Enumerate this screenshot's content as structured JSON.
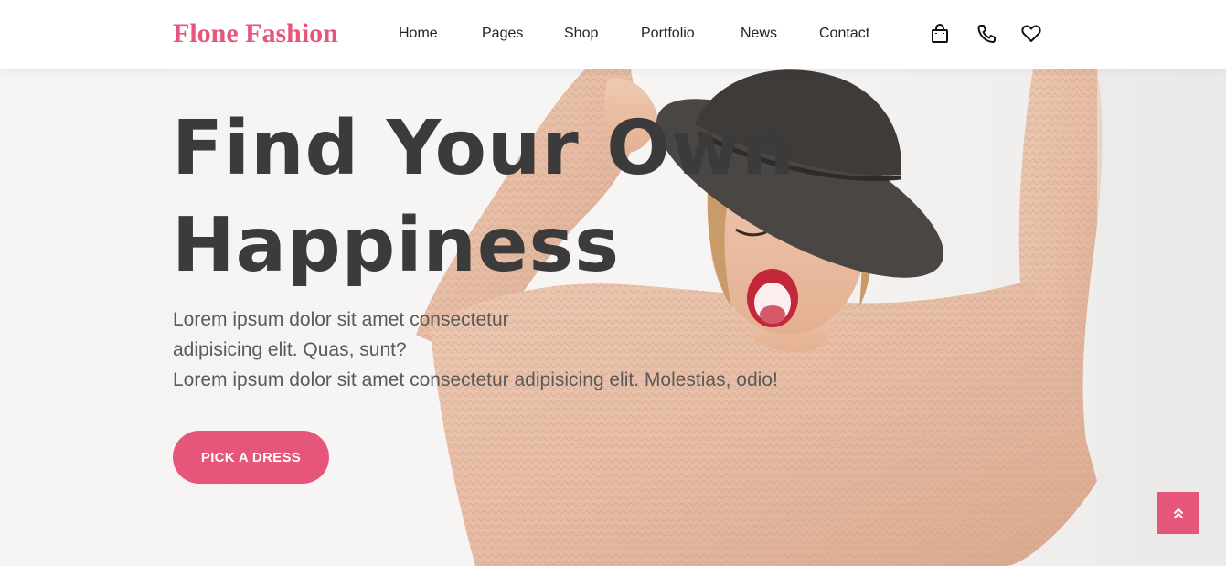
{
  "brand": {
    "name": "Flone Fashion",
    "accent": "#e5567a"
  },
  "nav": {
    "items": [
      {
        "label": "Home"
      },
      {
        "label": "Pages"
      },
      {
        "label": "Shop"
      },
      {
        "label": "Portfolio"
      },
      {
        "label": "News"
      },
      {
        "label": "Contact"
      }
    ],
    "icons": [
      "shopping-bag-icon",
      "phone-icon",
      "heart-icon"
    ]
  },
  "hero": {
    "title_line1": "Find Your Own",
    "title_line2": "Happiness",
    "subtitle_line1": "Lorem ipsum dolor sit amet consectetur",
    "subtitle_line2": "adipisicing elit. Quas, sunt?",
    "subtitle_line3": "Lorem ipsum dolor sit amet consectetur adipisicing elit. Molestias, odio!",
    "button_label": "PICK A DRESS"
  },
  "scroll_top": {
    "icon": "double-chevron-up-icon"
  }
}
